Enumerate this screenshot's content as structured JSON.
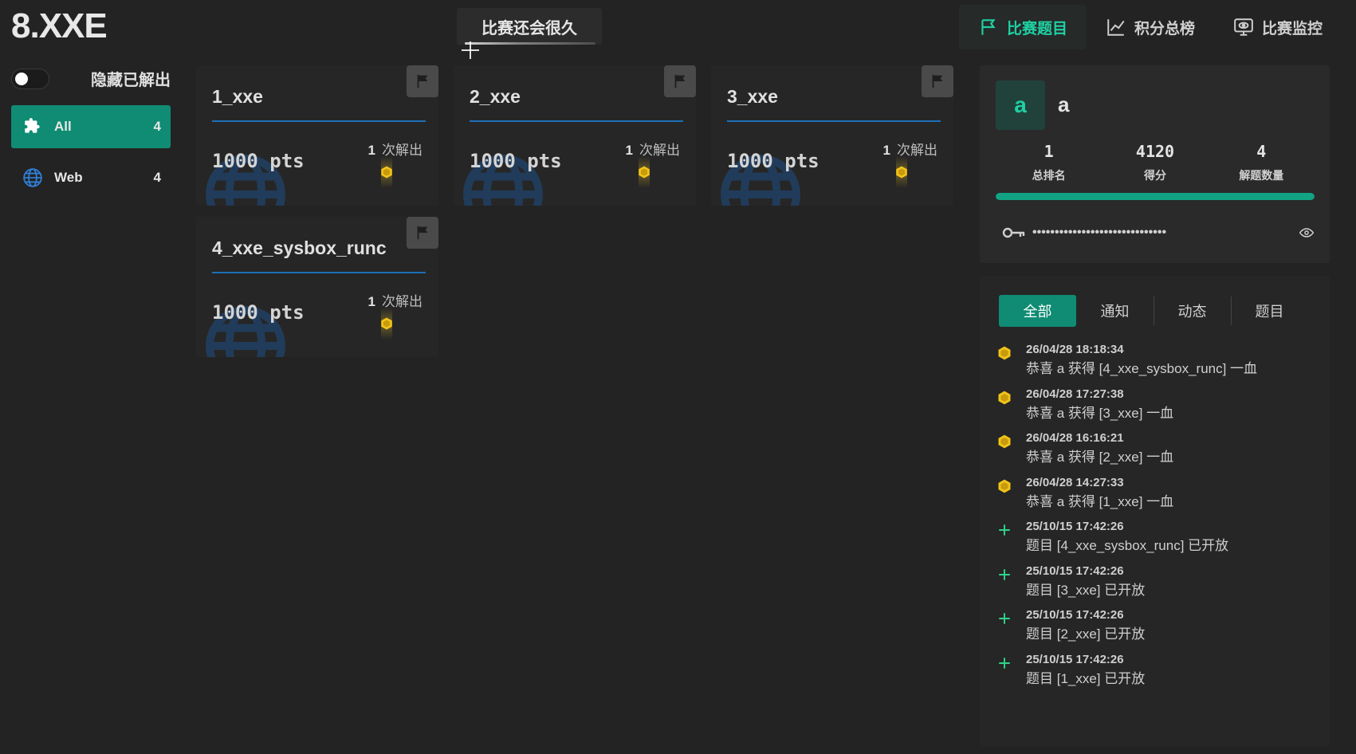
{
  "app_title": "8.XXE",
  "countdown": "比赛还会很久",
  "nav": [
    {
      "label": "比赛题目",
      "icon": "flag-icon",
      "active": true
    },
    {
      "label": "积分总榜",
      "icon": "chart-line-icon",
      "active": false
    },
    {
      "label": "比赛监控",
      "icon": "monitor-eye-icon",
      "active": false
    }
  ],
  "hide_solved": {
    "label": "隐藏已解出",
    "checked": false
  },
  "categories": [
    {
      "name": "All",
      "count": "4",
      "icon": "puzzle-icon",
      "active": true
    },
    {
      "name": "Web",
      "count": "4",
      "icon": "globe-icon",
      "active": false
    }
  ],
  "challenges": [
    {
      "title": "1_xxe",
      "points": "1000 pts",
      "solves": "1",
      "solves_label": "次解出"
    },
    {
      "title": "2_xxe",
      "points": "1000 pts",
      "solves": "1",
      "solves_label": "次解出"
    },
    {
      "title": "3_xxe",
      "points": "1000 pts",
      "solves": "1",
      "solves_label": "次解出"
    },
    {
      "title": "4_xxe_sysbox_runc",
      "points": "1000 pts",
      "solves": "1",
      "solves_label": "次解出"
    }
  ],
  "user": {
    "avatar_letter": "a",
    "name": "a",
    "rank": "1",
    "rank_label": "总排名",
    "score": "4120",
    "score_label": "得分",
    "solved": "4",
    "solved_label": "解题数量",
    "progress_fraction": 1.0,
    "token_masked": "••••••••••••••••••••••••••••••"
  },
  "feed_tabs": [
    "全部",
    "通知",
    "动态",
    "题目"
  ],
  "feed": [
    {
      "type": "blood",
      "time": "26/04/28 18:18:34",
      "text": "恭喜 a 获得 [4_xxe_sysbox_runc] 一血"
    },
    {
      "type": "blood",
      "time": "26/04/28 17:27:38",
      "text": "恭喜 a 获得 [3_xxe] 一血"
    },
    {
      "type": "blood",
      "time": "26/04/28 16:16:21",
      "text": "恭喜 a 获得 [2_xxe] 一血"
    },
    {
      "type": "blood",
      "time": "26/04/28 14:27:33",
      "text": "恭喜 a 获得 [1_xxe] 一血"
    },
    {
      "type": "new",
      "time": "25/10/15 17:42:26",
      "text": "题目 [4_xxe_sysbox_runc] 已开放"
    },
    {
      "type": "new",
      "time": "25/10/15 17:42:26",
      "text": "题目 [3_xxe] 已开放"
    },
    {
      "type": "new",
      "time": "25/10/15 17:42:26",
      "text": "题目 [2_xxe] 已开放"
    },
    {
      "type": "new",
      "time": "25/10/15 17:42:26",
      "text": "题目 [1_xxe] 已开放"
    }
  ],
  "colors": {
    "accent": "#0f8c73",
    "accent_text": "#1fd0a3",
    "blood": "#f0c419",
    "new": "#2fd38a",
    "category_line": "#1d6fb8"
  }
}
